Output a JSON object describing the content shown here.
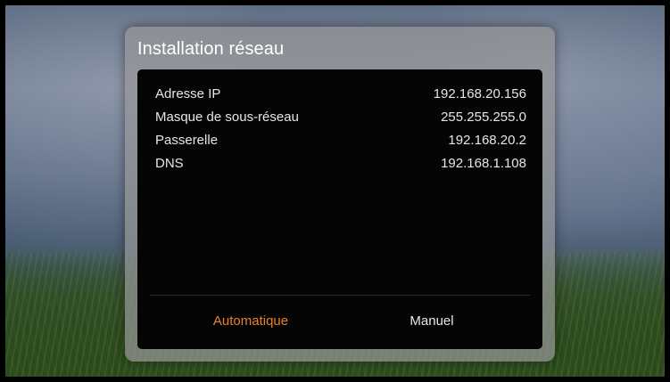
{
  "dialog": {
    "title": "Installation réseau"
  },
  "network_info": [
    {
      "label": "Adresse IP",
      "value": "192.168.20.156"
    },
    {
      "label": "Masque de sous-réseau",
      "value": "255.255.255.0"
    },
    {
      "label": "Passerelle",
      "value": "192.168.20.2"
    },
    {
      "label": "DNS",
      "value": "192.168.1.108"
    }
  ],
  "buttons": {
    "automatic": "Automatique",
    "manual": "Manuel"
  },
  "colors": {
    "accent_selected": "#e8822a",
    "text": "#e6e6e6",
    "panel": "#050505"
  }
}
